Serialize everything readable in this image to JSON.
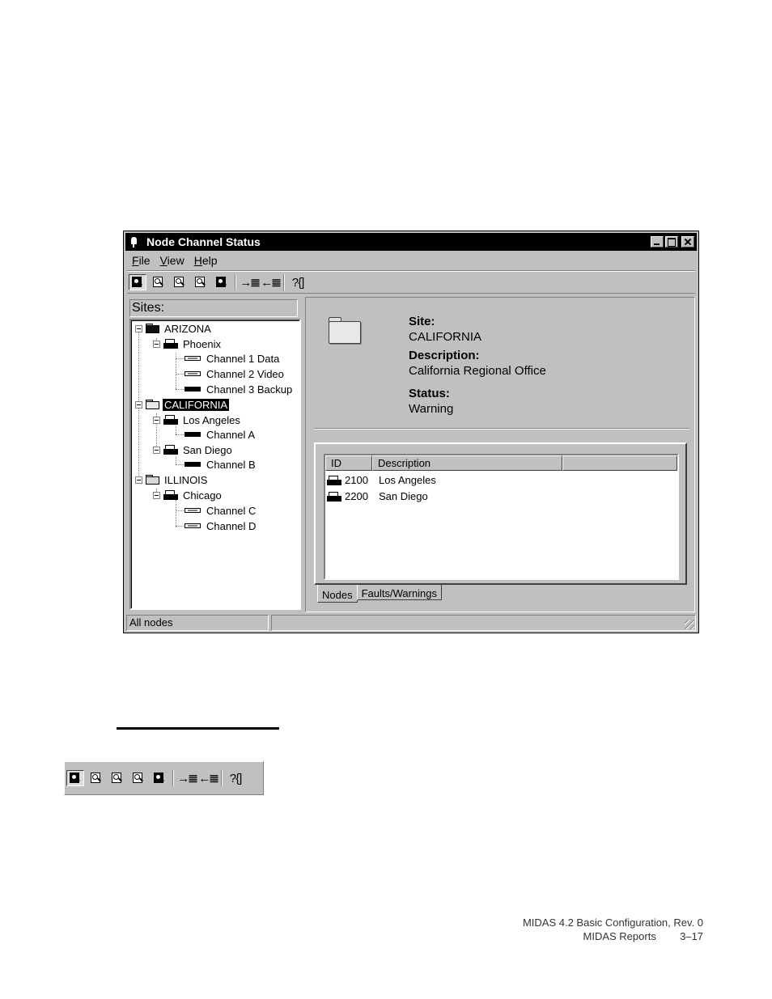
{
  "window": {
    "title": "Node Channel Status",
    "menu": [
      "File",
      "View",
      "Help"
    ]
  },
  "toolbar_icons": [
    "find-all-icon",
    "find-icon",
    "find-icon",
    "find-icon",
    "find-dark-icon",
    "indent-right-icon",
    "indent-left-icon",
    "help-icon"
  ],
  "toolbar_text": {
    "indent_in": "→≣",
    "indent_out": "←≣",
    "help": "?{]"
  },
  "sites": {
    "header": "Sites:",
    "tree": [
      {
        "label": "ARIZONA",
        "level": 0,
        "icon": "folder-dark-icon"
      },
      {
        "label": "Phoenix",
        "level": 1,
        "icon": "node-icon"
      },
      {
        "label": "Channel 1 Data",
        "level": 2,
        "icon": "channel-icon"
      },
      {
        "label": "Channel 2 Video",
        "level": 2,
        "icon": "channel-icon"
      },
      {
        "label": "Channel 3 Backup",
        "level": 2,
        "icon": "channel-dark-icon"
      },
      {
        "label": "CALIFORNIA",
        "level": 0,
        "icon": "folder-open-icon",
        "selected": true
      },
      {
        "label": "Los Angeles",
        "level": 1,
        "icon": "node-icon"
      },
      {
        "label": "Channel A",
        "level": 2,
        "icon": "channel-dark-icon"
      },
      {
        "label": "San Diego",
        "level": 1,
        "icon": "node-icon"
      },
      {
        "label": "Channel B",
        "level": 2,
        "icon": "channel-dark-icon"
      },
      {
        "label": "ILLINOIS",
        "level": 0,
        "icon": "folder-icon"
      },
      {
        "label": "Chicago",
        "level": 1,
        "icon": "node-icon"
      },
      {
        "label": "Channel C",
        "level": 2,
        "icon": "channel-icon"
      },
      {
        "label": "Channel D",
        "level": 2,
        "icon": "channel-icon"
      }
    ]
  },
  "detail": {
    "site_label": "Site:",
    "site_value": "CALIFORNIA",
    "desc_label": "Description:",
    "desc_value": "California Regional Office",
    "status_label": "Status:",
    "status_value": "Warning"
  },
  "list": {
    "columns": [
      "ID",
      "Description",
      ""
    ],
    "rows": [
      {
        "id": "2100",
        "description": "Los Angeles"
      },
      {
        "id": "2200",
        "description": "San Diego"
      }
    ]
  },
  "tabs": [
    "Nodes",
    "Faults/Warnings"
  ],
  "statusbar": {
    "text": "All nodes"
  },
  "footer": {
    "line1": "MIDAS 4.2 Basic Configuration, Rev. 0",
    "line2_left": "MIDAS Reports",
    "line2_right": "3–17"
  }
}
